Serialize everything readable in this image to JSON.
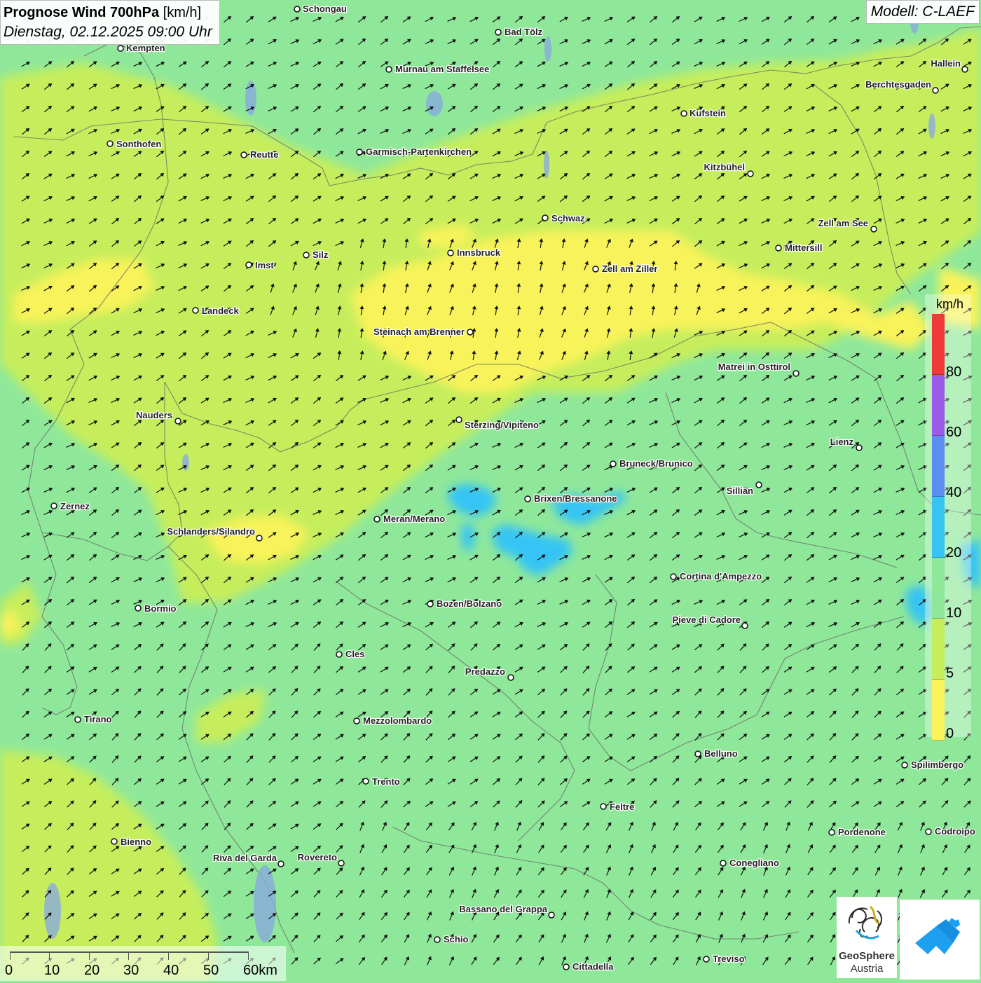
{
  "title": {
    "main_bold": "Prognose Wind 700hPa",
    "main_unit": "[km/h]",
    "subtitle": "Dienstag, 02.12.2025 09:00 Uhr"
  },
  "model": "Modell: C-LAEF",
  "legend": {
    "unit": "km/h",
    "classes": [
      {
        "label": "80",
        "color": "#f03a3a"
      },
      {
        "label": "60",
        "color": "#9b5be8"
      },
      {
        "label": "40",
        "color": "#5b8ef0"
      },
      {
        "label": "20",
        "color": "#35c4f4"
      },
      {
        "label": "10",
        "color": "#8fe89a"
      },
      {
        "label": "5",
        "color": "#c6ee5c"
      },
      {
        "label": "0",
        "color": "#f8f35a"
      }
    ]
  },
  "scalebar": {
    "labels": [
      "0",
      "10",
      "20",
      "30",
      "40",
      "50",
      "60km"
    ]
  },
  "logos": {
    "geosphere_line1": "GeoSphere",
    "geosphere_line2": "Austria"
  },
  "cities": [
    {
      "name": "Schongau"
    },
    {
      "name": "Bad Tölz"
    },
    {
      "name": "Kempten"
    },
    {
      "name": "Murnau am Staffelsee"
    },
    {
      "name": "Hallein"
    },
    {
      "name": "Berchtesgaden"
    },
    {
      "name": "Kufstein"
    },
    {
      "name": "Sonthofen"
    },
    {
      "name": "Reutte"
    },
    {
      "name": "Garmisch-Partenkirchen"
    },
    {
      "name": "Kitzbühel"
    },
    {
      "name": "Schwaz"
    },
    {
      "name": "Zell am See"
    },
    {
      "name": "Innsbruck"
    },
    {
      "name": "Mittersill"
    },
    {
      "name": "Imst"
    },
    {
      "name": "Silz"
    },
    {
      "name": "Zell am Ziller"
    },
    {
      "name": "Landeck"
    },
    {
      "name": "Steinach am Brenner"
    },
    {
      "name": "Matrei in Osttirol"
    },
    {
      "name": "Nauders"
    },
    {
      "name": "Sterzing/Vipiteno"
    },
    {
      "name": "Lienz"
    },
    {
      "name": "Bruneck/Brunico"
    },
    {
      "name": "Sillian"
    },
    {
      "name": "Zernez"
    },
    {
      "name": "Brixen/Bressanone"
    },
    {
      "name": "Meran/Merano"
    },
    {
      "name": "Schlanders/Silandro"
    },
    {
      "name": "Cortina d'Ampezzo"
    },
    {
      "name": "Bozen/Bolzano"
    },
    {
      "name": "Bormio"
    },
    {
      "name": "Pieve di Cadore"
    },
    {
      "name": "Cles"
    },
    {
      "name": "Predazzo"
    },
    {
      "name": "Tirano"
    },
    {
      "name": "Mezzolombardo"
    },
    {
      "name": "Belluno"
    },
    {
      "name": "Spilimbergo"
    },
    {
      "name": "Trento"
    },
    {
      "name": "Feltre"
    },
    {
      "name": "Bienno"
    },
    {
      "name": "Pordenone"
    },
    {
      "name": "Codroipo"
    },
    {
      "name": "Riva del Garda"
    },
    {
      "name": "Rovereto"
    },
    {
      "name": "Conegliano"
    },
    {
      "name": "Bassano del Grappa"
    },
    {
      "name": "Schio"
    },
    {
      "name": "Treviso"
    },
    {
      "name": "Cittadella"
    }
  ]
}
